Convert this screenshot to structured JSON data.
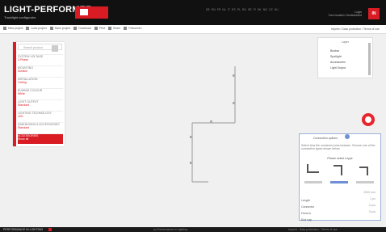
{
  "header": {
    "logo_text": "LIGHT-PERFORMER",
    "logo_sub": "Tracklight configurator",
    "nav_links": [
      "DE",
      "EN",
      "FR",
      "NL",
      "IT",
      "ES",
      "PL",
      "RU",
      "SE",
      "FI",
      "DK",
      "NO",
      "CZ",
      "HU"
    ],
    "account_line1": "Login",
    "account_line2": "Your location: Deutschland",
    "user_badge": "IN"
  },
  "toolbar": {
    "items": [
      "New project",
      "Load project",
      "Save project",
      "Download",
      "Print",
      "Share",
      "Fullscreen"
    ],
    "right_text": "Imprint / Data protection / Terms of use"
  },
  "left_panel": {
    "search_placeholder": "Search product",
    "menu": [
      {
        "title": "SYSTEM VOLTAGE",
        "value": "3-Phase"
      },
      {
        "title": "MOUNTING",
        "value": "Surface"
      },
      {
        "title": "INSTALLATION",
        "value": "Ceiling"
      },
      {
        "title": "BUSBAR COLOUR",
        "value": "White"
      },
      {
        "title": "LIGHT OUTPUT",
        "value": "Standard"
      },
      {
        "title": "LIGHTING TECHNOLOGY",
        "value": "LED"
      },
      {
        "title": "DIMENSIONS & ACCESSORIES",
        "value": "Standard"
      },
      {
        "title": "ACCESSORIES",
        "value": "Show all"
      }
    ]
  },
  "overview": {
    "title": "Layer",
    "items": [
      "Busbar",
      "Spotlight",
      "Accessories",
      "Light Output"
    ]
  },
  "config_panel": {
    "title": "Connection options",
    "description": "Select how the connector joins busbars. Choose one of the connection types shown below.",
    "subtitle": "Please select a type",
    "rows": [
      {
        "label": "Length",
        "value": "2000 mm"
      },
      {
        "label": "Connector",
        "value": "1 pc"
      },
      {
        "label": "Feed-in",
        "value": "2 pcs"
      },
      {
        "label": "End cap",
        "value": "3 pcs"
      }
    ]
  },
  "footer": {
    "left": "PERFORMANCE IN LIGHTING",
    "mid": "(c) Performance in Lighting",
    "right": "Imprint - Data protection - Terms of use"
  },
  "colors": {
    "accent_red": "#d91c24",
    "topbar": "#111111",
    "config_border": "#9db0d8",
    "selected_blue": "#6f8fd6"
  },
  "icons": [
    "menu-icon",
    "layers-icon",
    "info-icon",
    "record-icon",
    "close-icon"
  ]
}
